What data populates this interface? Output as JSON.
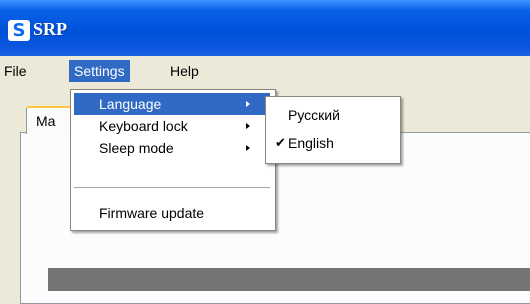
{
  "window": {
    "title": "SRP",
    "icon": "S"
  },
  "menubar": {
    "items": [
      "File",
      "Settings",
      "Help"
    ],
    "active": "Settings"
  },
  "tabs": [
    {
      "label": "Ma"
    }
  ],
  "settings_menu": {
    "items": [
      {
        "label": "Language",
        "has_submenu": true,
        "highlighted": true
      },
      {
        "label": "Keyboard lock",
        "has_submenu": true
      },
      {
        "label": "Sleep mode",
        "has_submenu": true
      },
      {
        "label": "Firmware update",
        "has_submenu": false
      }
    ]
  },
  "language_menu": {
    "items": [
      {
        "label": "Русский",
        "checked": false
      },
      {
        "label": "English",
        "checked": true
      }
    ]
  },
  "colors": {
    "titlebar": "#0051d9",
    "highlight": "#316ac5",
    "tab_accent": "#ffc73c"
  },
  "icons": {
    "app": "srp-app-icon",
    "check": "checkmark-icon",
    "submenu": "submenu-arrow-icon"
  }
}
